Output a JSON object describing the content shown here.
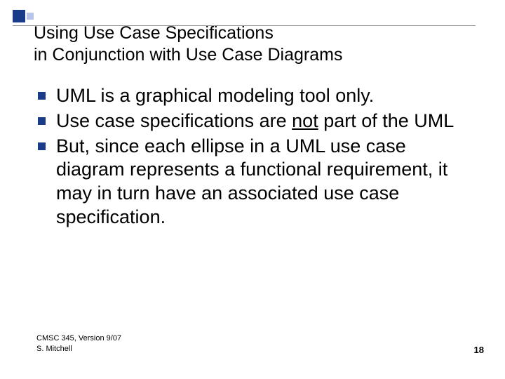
{
  "title": {
    "line1": "Using Use Case Specifications",
    "line2": " in Conjunction with Use Case Diagrams"
  },
  "bullets": [
    {
      "text": "UML is a graphical modeling tool only."
    },
    {
      "pre": "Use case specifications are ",
      "u": "not",
      "post": " part of the UML"
    },
    {
      "text": "But, since each ellipse in a UML use case diagram represents a functional requirement, it may in turn have an associated use case specification."
    }
  ],
  "footer": {
    "line1": "CMSC 345, Version 9/07",
    "line2": "S. Mitchell"
  },
  "page_number": "18"
}
